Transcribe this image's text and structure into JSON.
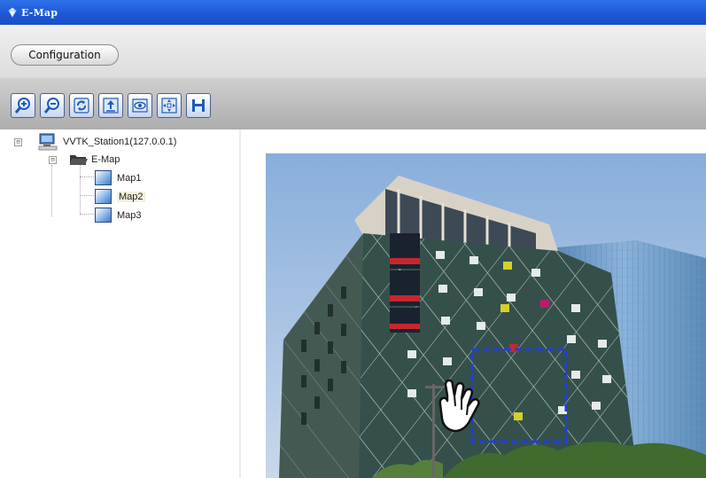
{
  "window": {
    "title": "E-Map",
    "app_icon": "emap-diamond-icon"
  },
  "menu": {
    "configuration_label": "Configuration"
  },
  "toolbar": {
    "buttons": [
      {
        "name": "zoom-in",
        "icon": "zoom-in-icon"
      },
      {
        "name": "zoom-out",
        "icon": "zoom-out-icon"
      },
      {
        "name": "refresh",
        "icon": "refresh-icon"
      },
      {
        "name": "upload",
        "icon": "upload-icon"
      },
      {
        "name": "view",
        "icon": "eye-icon"
      },
      {
        "name": "fit-to-window",
        "icon": "fit-window-icon"
      },
      {
        "name": "save",
        "icon": "save-icon"
      }
    ]
  },
  "tree": {
    "station": {
      "label": "VVTK_Station1(127.0.0.1)",
      "icon": "computer-icon",
      "expander": "⊟"
    },
    "emap": {
      "label": "E-Map",
      "icon": "folder-open-icon",
      "expander": "⊟"
    },
    "maps": [
      {
        "label": "Map1",
        "selected": false
      },
      {
        "label": "Map2",
        "selected": true
      },
      {
        "label": "Map3",
        "selected": false
      }
    ]
  },
  "map_view": {
    "image": "building-photo",
    "camera_zone": "dashed-blue-selection",
    "cursor": "hand-pointer-icon"
  },
  "colors": {
    "titlebar": "#1d58d6",
    "toolbar_gray": "#b8b8b8",
    "zone_border": "#1e3fd8",
    "sky": "#9fc0e2"
  }
}
